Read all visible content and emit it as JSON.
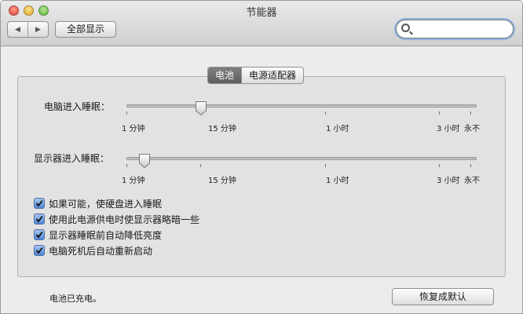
{
  "window": {
    "title": "节能器"
  },
  "toolbar": {
    "back_icon": "◀",
    "forward_icon": "▶",
    "show_all_label": "全部显示",
    "search_value": "",
    "search_placeholder": ""
  },
  "tabs": [
    {
      "label": "电池",
      "active": true
    },
    {
      "label": "电源适配器",
      "active": false
    }
  ],
  "sliders": {
    "computer_sleep": {
      "label": "电脑进入睡眠：",
      "ticks": [
        "1 分钟",
        "15 分钟",
        "1 小时",
        "3 小时",
        "永不"
      ],
      "value_fraction": 0.21
    },
    "display_sleep": {
      "label": "显示器进入睡眠：",
      "ticks": [
        "1 分钟",
        "15 分钟",
        "1 小时",
        "3 小时",
        "永不"
      ],
      "value_fraction": 0.05
    }
  },
  "options": [
    {
      "label": "如果可能，使硬盘进入睡眠",
      "checked": true
    },
    {
      "label": "使用此电源供电时使显示器略暗一些",
      "checked": true
    },
    {
      "label": "显示器睡眠前自动降低亮度",
      "checked": true
    },
    {
      "label": "电脑死机后自动重新启动",
      "checked": true
    }
  ],
  "footer": {
    "status_text": "电池已充电。",
    "restore_label": "恢复成默认"
  },
  "colors": {
    "accent": "#4f86d6",
    "active_tab": "#6f6f6f"
  }
}
